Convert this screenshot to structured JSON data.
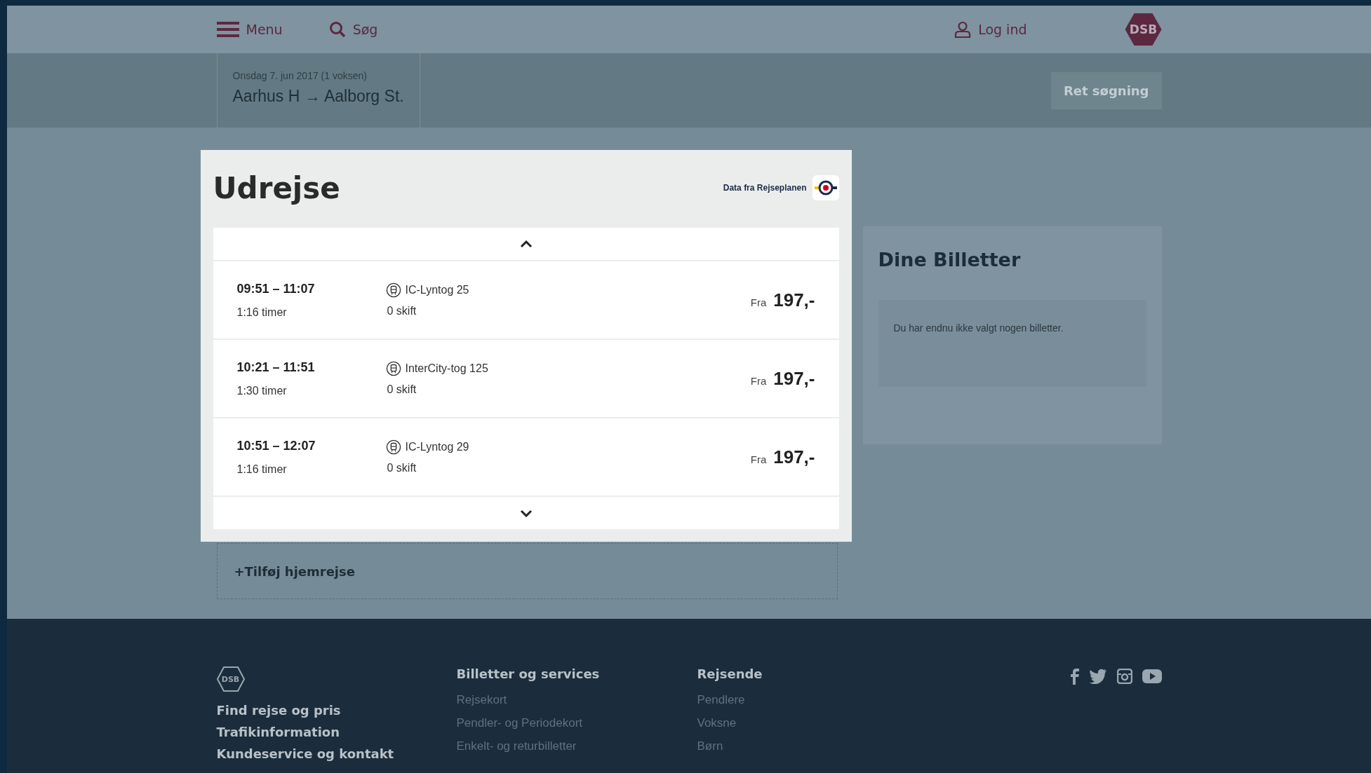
{
  "header": {
    "menu_label": "Menu",
    "search_label": "Søg",
    "login_label": "Log ind",
    "logo": "DSB"
  },
  "search_summary": {
    "date": "Onsdag 7. jun 2017 (1 voksen)",
    "route": "Aarhus H → Aalborg St.",
    "edit_button": "Ret søgning"
  },
  "modal": {
    "title": "Udrejse",
    "source": "Data fra Rejseplanen",
    "departures": [
      {
        "times": "09:51 – 11:07",
        "duration": "1:16 timer",
        "train": "IC-Lyntog 25",
        "changes": "0 skift",
        "price_prefix": "Fra",
        "price": "197,-"
      },
      {
        "times": "10:21 – 11:51",
        "duration": "1:30 timer",
        "train": "InterCity-tog 125",
        "changes": "0 skift",
        "price_prefix": "Fra",
        "price": "197,-"
      },
      {
        "times": "10:51 – 12:07",
        "duration": "1:16 timer",
        "train": "IC-Lyntog 29",
        "changes": "0 skift",
        "price_prefix": "Fra",
        "price": "197,-"
      }
    ]
  },
  "add_return": "+Tilføj hjemrejse",
  "tickets": {
    "title": "Dine Billetter",
    "empty_text": "Du har endnu ikke valgt nogen billetter."
  },
  "footer": {
    "logo": "DSB",
    "main_links": [
      "Find rejse og pris",
      "Trafikinformation",
      "Kundeservice og kontakt"
    ],
    "columns": [
      {
        "heading": "Billetter og services",
        "links": [
          "Rejsekort",
          "Pendler- og Periodekort",
          "Enkelt- og returbilletter"
        ]
      },
      {
        "heading": "Rejsende",
        "links": [
          "Pendlere",
          "Voksne",
          "Børn"
        ]
      }
    ]
  }
}
